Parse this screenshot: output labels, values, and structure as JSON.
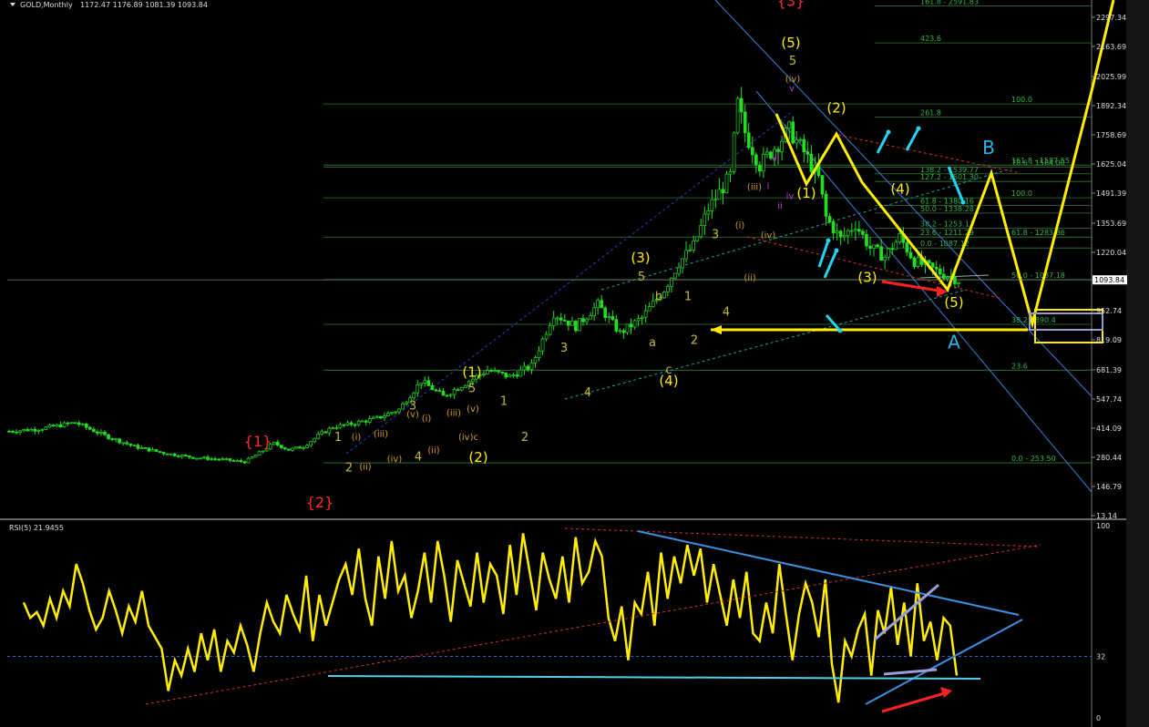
{
  "header": {
    "main_title": "GOLD,Monthly",
    "ohlc": "1172.47 1176.89 1081.39 1093.84",
    "rsi_title": "RSI(5) 21.9455"
  },
  "colors": {
    "background": "#000000",
    "candle": "#22dd22",
    "fib_line": "#2e7d32",
    "fib_text": "#39b34a",
    "rsi_line": "#ffee00",
    "annotation_yellow": "#ffee00",
    "annotation_cyan": "#22d3ee",
    "annotation_red": "#ff2222",
    "trend_blue": "#3d7bd6",
    "wave_major_red": "#ff2a2a",
    "wave_orange": "#d69a1e"
  },
  "chart_data": [
    {
      "type": "candlestick",
      "symbol": "GOLD",
      "timeframe": "Monthly",
      "last_price": 1093.84,
      "y_ticks": [
        "2297.34",
        "2163.69",
        "2025.99",
        "1892.34",
        "1758.69",
        "1625.04",
        "1491.39",
        "1353.69",
        "1220.04",
        "1093.84",
        "952.74",
        "819.09",
        "681.39",
        "547.74",
        "414.09",
        "280.44",
        "146.79",
        "13.14"
      ],
      "ylim": [
        13.14,
        2360
      ],
      "price_path": [
        [
          0,
          400
        ],
        [
          8,
          410
        ],
        [
          18,
          440
        ],
        [
          26,
          380
        ],
        [
          34,
          330
        ],
        [
          42,
          300
        ],
        [
          50,
          280
        ],
        [
          58,
          270
        ],
        [
          64,
          260
        ],
        [
          68,
          300
        ],
        [
          72,
          345
        ],
        [
          76,
          315
        ],
        [
          80,
          330
        ],
        [
          84,
          380
        ],
        [
          88,
          420
        ],
        [
          92,
          430
        ],
        [
          96,
          445
        ],
        [
          100,
          460
        ],
        [
          106,
          500
        ],
        [
          112,
          630
        ],
        [
          118,
          560
        ],
        [
          124,
          620
        ],
        [
          130,
          680
        ],
        [
          136,
          650
        ],
        [
          142,
          700
        ],
        [
          148,
          940
        ],
        [
          154,
          880
        ],
        [
          160,
          980
        ],
        [
          166,
          850
        ],
        [
          172,
          920
        ],
        [
          178,
          1050
        ],
        [
          182,
          1170
        ],
        [
          186,
          1250
        ],
        [
          190,
          1420
        ],
        [
          196,
          1570
        ],
        [
          198,
          1900
        ],
        [
          200,
          1770
        ],
        [
          204,
          1620
        ],
        [
          208,
          1700
        ],
        [
          212,
          1780
        ],
        [
          216,
          1680
        ],
        [
          220,
          1560
        ],
        [
          222,
          1380
        ],
        [
          226,
          1280
        ],
        [
          230,
          1350
        ],
        [
          234,
          1240
        ],
        [
          238,
          1200
        ],
        [
          242,
          1290
        ],
        [
          246,
          1180
        ],
        [
          250,
          1150
        ],
        [
          254,
          1120
        ],
        [
          258,
          1093.84
        ]
      ],
      "fib_levels": [
        {
          "label": "423.6",
          "price": 2180
        },
        {
          "label": "100.0",
          "price": 1900
        },
        {
          "label": "261.8",
          "price": 1840
        },
        {
          "label": "161.8 - 1587.55",
          "price": 1620
        },
        {
          "label": "138.2 - 1539.77",
          "price": 1580
        },
        {
          "label": "127.2 - 1501.30",
          "price": 1545
        },
        {
          "label": "78.6 - 1564.00",
          "price": 1610
        },
        {
          "label": "100.0",
          "price": 1470
        },
        {
          "label": "61.8 - 1380.16",
          "price": 1435
        },
        {
          "label": "50.0 - 1338.28",
          "price": 1400
        },
        {
          "label": "61.8 - 1283.86",
          "price": 1290
        },
        {
          "label": "38.2 - 1253.13",
          "price": 1330
        },
        {
          "label": "23.6 - 1211.29",
          "price": 1290
        },
        {
          "label": "0.0 - 1087.12",
          "price": 1240
        },
        {
          "label": "50.0 - 1087.18",
          "price": 1095
        },
        {
          "label": "38.2 - 890.4",
          "price": 890
        },
        {
          "label": "23.6",
          "price": 680
        },
        {
          "label": "0.0 - 253.50",
          "price": 255
        },
        {
          "label": "161.8 - 2591.83",
          "price": 2350
        }
      ],
      "wave_labels": [
        {
          "text": "{3}",
          "color": "red",
          "price": 2350,
          "x": 868
        },
        {
          "text": "{1}",
          "color": "red",
          "price": 330,
          "x": 283
        },
        {
          "text": "{2}",
          "color": "red",
          "price": 50,
          "x": 351
        },
        {
          "text": "(5)",
          "color": "yellow",
          "price": 2160,
          "x": 868
        },
        {
          "text": "5",
          "color": "olive",
          "price": 2080,
          "x": 870
        },
        {
          "text": "(iv)",
          "color": "orange",
          "price": 2000,
          "x": 870
        },
        {
          "text": "v",
          "color": "magenta",
          "price": 1960,
          "x": 869
        },
        {
          "text": "(2)",
          "color": "yellow",
          "price": 1860,
          "x": 918
        },
        {
          "text": "(1)",
          "color": "yellow",
          "price": 1470,
          "x": 885
        },
        {
          "text": "(4)",
          "color": "yellow",
          "price": 1490,
          "x": 988
        },
        {
          "text": "(3)",
          "color": "yellow",
          "price": 1085,
          "x": 952
        },
        {
          "text": "(5)",
          "color": "yellow",
          "price": 970,
          "x": 1047
        },
        {
          "text": "B",
          "color": "cyan",
          "price": 1670,
          "x": 1085
        },
        {
          "text": "A",
          "color": "cyan",
          "price": 780,
          "x": 1047
        },
        {
          "text": "(3)",
          "color": "yellow",
          "price": 1175,
          "x": 703
        },
        {
          "text": "5",
          "color": "olive",
          "price": 1090,
          "x": 704
        },
        {
          "text": "(4)",
          "color": "yellow",
          "price": 610,
          "x": 734
        },
        {
          "text": "c",
          "color": "olive",
          "price": 665,
          "x": 734
        },
        {
          "text": "(1)",
          "color": "yellow",
          "price": 650,
          "x": 518
        },
        {
          "text": "5",
          "color": "olive",
          "price": 580,
          "x": 518
        },
        {
          "text": "(2)",
          "color": "yellow",
          "price": 260,
          "x": 525
        },
        {
          "text": "(v)",
          "color": "orange",
          "price": 490,
          "x": 519
        },
        {
          "text": "(iv)c",
          "color": "orange",
          "price": 360,
          "x": 514
        },
        {
          "text": "(iii)",
          "color": "orange",
          "price": 470,
          "x": 498
        },
        {
          "text": "1",
          "color": "olive",
          "price": 520,
          "x": 553
        },
        {
          "text": "2",
          "color": "olive",
          "price": 355,
          "x": 576
        },
        {
          "text": "3",
          "color": "olive",
          "price": 765,
          "x": 619
        },
        {
          "text": "4",
          "color": "olive",
          "price": 560,
          "x": 645
        },
        {
          "text": "3",
          "color": "olive",
          "price": 500,
          "x": 453
        },
        {
          "text": "(v)",
          "color": "orange",
          "price": 465,
          "x": 453
        },
        {
          "text": "(i)",
          "color": "orange",
          "price": 445,
          "x": 468
        },
        {
          "text": "(ii)",
          "color": "orange",
          "price": 300,
          "x": 476
        },
        {
          "text": "4",
          "color": "olive",
          "price": 265,
          "x": 459
        },
        {
          "text": "(iv)",
          "color": "orange",
          "price": 260,
          "x": 433
        },
        {
          "text": "(iii)",
          "color": "orange",
          "price": 375,
          "x": 418
        },
        {
          "text": "1",
          "color": "olive",
          "price": 355,
          "x": 371
        },
        {
          "text": "(i)",
          "color": "orange",
          "price": 360,
          "x": 391
        },
        {
          "text": "2",
          "color": "olive",
          "price": 215,
          "x": 383
        },
        {
          "text": "(ii)",
          "color": "orange",
          "price": 225,
          "x": 401
        },
        {
          "text": "3",
          "color": "olive",
          "price": 1285,
          "x": 785
        },
        {
          "text": "1",
          "color": "olive",
          "price": 1000,
          "x": 755
        },
        {
          "text": "2",
          "color": "olive",
          "price": 800,
          "x": 762
        },
        {
          "text": "4",
          "color": "olive",
          "price": 930,
          "x": 797
        },
        {
          "text": "b",
          "color": "olive",
          "price": 1000,
          "x": 723
        },
        {
          "text": "a",
          "color": "olive",
          "price": 790,
          "x": 716
        },
        {
          "text": "(i)",
          "color": "orange",
          "price": 1330,
          "x": 812
        },
        {
          "text": "(ii)",
          "color": "orange",
          "price": 1090,
          "x": 823
        },
        {
          "text": "(iii)",
          "color": "orange",
          "price": 1505,
          "x": 828
        },
        {
          "text": "(iv)",
          "color": "orange",
          "price": 1285,
          "x": 843
        },
        {
          "text": "iii",
          "color": "magenta",
          "price": 1640,
          "x": 851
        },
        {
          "text": "i",
          "color": "magenta",
          "price": 1510,
          "x": 843
        },
        {
          "text": "ii",
          "color": "magenta",
          "price": 1420,
          "x": 856
        },
        {
          "text": "iv",
          "color": "magenta",
          "price": 1465,
          "x": 867
        }
      ]
    },
    {
      "type": "line",
      "name": "RSI(5)",
      "last_value": 21.9455,
      "ylim": [
        0,
        100
      ],
      "y_ticks": [
        "100",
        "32",
        "0"
      ],
      "reference_levels": [
        32
      ],
      "values": [
        60,
        52,
        55,
        48,
        62,
        52,
        66,
        58,
        80,
        70,
        56,
        46,
        52,
        66,
        56,
        44,
        58,
        50,
        66,
        48,
        42,
        36,
        14,
        30,
        22,
        36,
        24,
        44,
        30,
        46,
        24,
        40,
        34,
        48,
        38,
        24,
        44,
        60,
        50,
        44,
        64,
        54,
        46,
        74,
        40,
        64,
        48,
        60,
        72,
        80,
        64,
        88,
        62,
        48,
        84,
        62,
        92,
        66,
        74,
        52,
        66,
        86,
        60,
        92,
        74,
        50,
        82,
        70,
        58,
        86,
        60,
        80,
        74,
        54,
        90,
        64,
        96,
        76,
        56,
        86,
        72,
        62,
        84,
        60,
        94,
        70,
        76,
        92,
        84,
        52,
        40,
        58,
        30,
        60,
        54,
        76,
        48,
        86,
        62,
        84,
        70,
        90,
        74,
        88,
        60,
        80,
        64,
        48,
        72,
        52,
        76,
        44,
        40,
        60,
        44,
        80,
        54,
        30,
        54,
        70,
        60,
        42,
        72,
        28,
        8,
        40,
        32,
        46,
        54,
        22,
        56,
        44,
        68,
        38,
        60,
        32,
        70,
        40,
        50,
        30,
        52,
        48,
        22
      ]
    }
  ]
}
